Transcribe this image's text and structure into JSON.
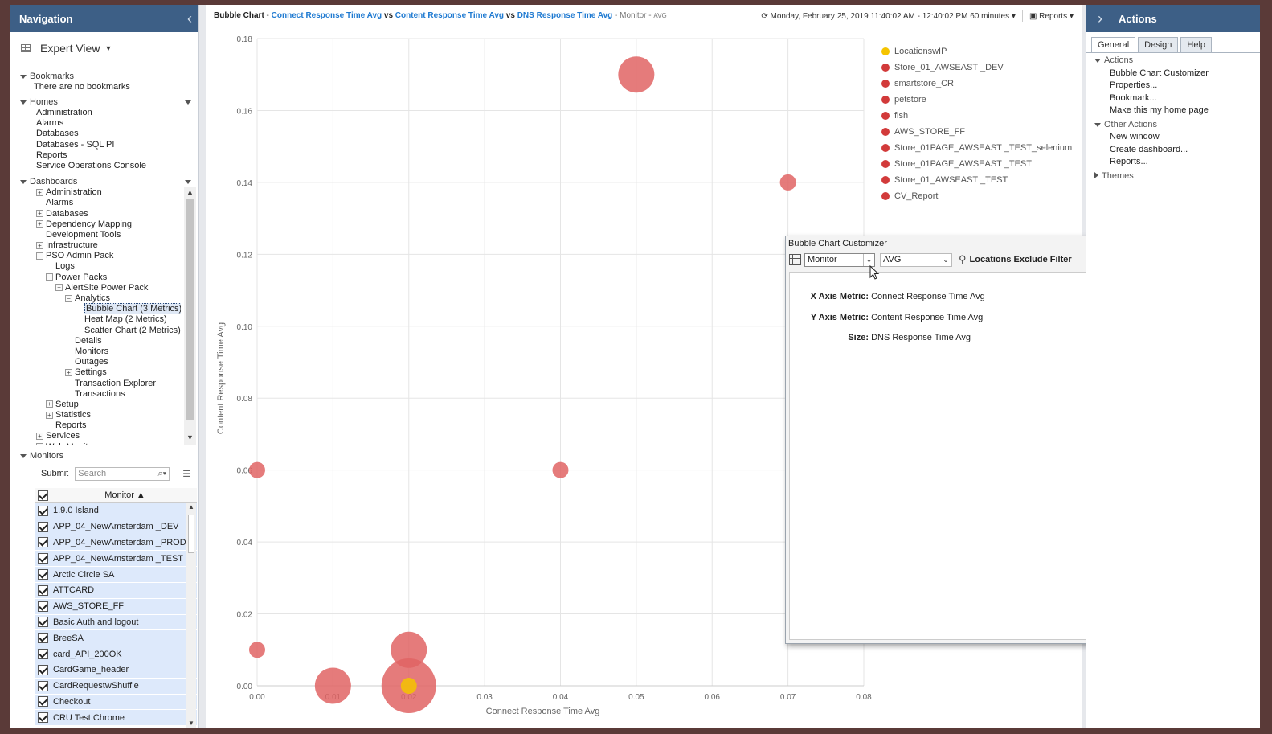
{
  "nav": {
    "title": "Navigation",
    "view_label": "Expert View",
    "bookmarks": {
      "title": "Bookmarks",
      "empty_text": "There are no bookmarks"
    },
    "homes": {
      "title": "Homes",
      "items": [
        "Administration",
        "Alarms",
        "Databases",
        "Databases - SQL PI",
        "Reports",
        "Service Operations Console"
      ]
    },
    "dashboards": {
      "title": "Dashboards",
      "items": [
        {
          "label": "Administration",
          "indent": 0,
          "exp": "+"
        },
        {
          "label": "Alarms",
          "indent": 0,
          "exp": ""
        },
        {
          "label": "Databases",
          "indent": 0,
          "exp": "+"
        },
        {
          "label": "Dependency Mapping",
          "indent": 0,
          "exp": "+"
        },
        {
          "label": "Development Tools",
          "indent": 0,
          "exp": ""
        },
        {
          "label": "Infrastructure",
          "indent": 0,
          "exp": "+"
        },
        {
          "label": "PSO Admin Pack",
          "indent": 0,
          "exp": "-"
        },
        {
          "label": "Logs",
          "indent": 1,
          "exp": ""
        },
        {
          "label": "Power Packs",
          "indent": 1,
          "exp": "-"
        },
        {
          "label": "AlertSite Power Pack",
          "indent": 2,
          "exp": "-"
        },
        {
          "label": "Analytics",
          "indent": 3,
          "exp": "-"
        },
        {
          "label": "Bubble Chart (3 Metrics)",
          "indent": 4,
          "exp": "",
          "selected": true
        },
        {
          "label": "Heat Map (2 Metrics)",
          "indent": 4,
          "exp": ""
        },
        {
          "label": "Scatter Chart (2 Metrics)",
          "indent": 4,
          "exp": ""
        },
        {
          "label": "Details",
          "indent": 3,
          "exp": ""
        },
        {
          "label": "Monitors",
          "indent": 3,
          "exp": ""
        },
        {
          "label": "Outages",
          "indent": 3,
          "exp": ""
        },
        {
          "label": "Settings",
          "indent": 3,
          "exp": "+"
        },
        {
          "label": "Transaction Explorer",
          "indent": 3,
          "exp": ""
        },
        {
          "label": "Transactions",
          "indent": 3,
          "exp": ""
        },
        {
          "label": "Setup",
          "indent": 1,
          "exp": "+"
        },
        {
          "label": "Statistics",
          "indent": 1,
          "exp": "+"
        },
        {
          "label": "Reports",
          "indent": 1,
          "exp": ""
        },
        {
          "label": "Services",
          "indent": 0,
          "exp": "+"
        },
        {
          "label": "Web Monitor",
          "indent": 0,
          "exp": "+"
        }
      ]
    },
    "monitors": {
      "title": "Monitors",
      "submit_label": "Submit",
      "search_placeholder": "Search",
      "column_header": "Monitor ▲",
      "rows": [
        "1.9.0 Island",
        "APP_04_NewAmsterdam _DEV",
        "APP_04_NewAmsterdam _PROD",
        "APP_04_NewAmsterdam _TEST",
        "Arctic Circle SA",
        "ATTCARD",
        "AWS_STORE_FF",
        "Basic Auth and logout",
        "BreeSA",
        "card_API_200OK",
        "CardGame_header",
        "CardRequestwShuffle",
        "Checkout",
        "CRU Test Chrome"
      ]
    }
  },
  "header": {
    "prefix": "Bubble Chart",
    "sep1": " - ",
    "metric_x": "Connect Response Time Avg",
    "vs1": " vs ",
    "metric_y": "Content Response Time Avg",
    "vs2": " vs ",
    "metric_size": "DNS Response Time Avg",
    "suffix": " - Monitor - ",
    "agg": "AVG",
    "time_range": "Monday, February 25, 2019 11:40:02 AM - 12:40:02 PM 60 minutes",
    "reports_label": "Reports"
  },
  "chart_data": {
    "type": "scatter",
    "xlabel": "Connect Response Time Avg",
    "ylabel": "Content Response Time Avg",
    "xlim": [
      0,
      0.08
    ],
    "ylim": [
      0,
      0.18
    ],
    "x_ticks": [
      "0.00",
      "0.01",
      "0.02",
      "0.03",
      "0.04",
      "0.05",
      "0.06",
      "0.07",
      "0.08"
    ],
    "y_ticks": [
      "0.00",
      "0.02",
      "0.04",
      "0.06",
      "0.08",
      "0.10",
      "0.12",
      "0.14",
      "0.16",
      "0.18"
    ],
    "grid": true,
    "legend": [
      "LocationswIP",
      "Store_01_AWSEAST _DEV",
      "smartstore_CR",
      "petstore",
      "fish",
      "AWS_STORE_FF",
      "Store_01PAGE_AWSEAST _TEST_selenium",
      "Store_01PAGE_AWSEAST _TEST",
      "Store_01_AWSEAST _TEST",
      "CV_Report"
    ],
    "legend_colors": [
      "#f5c400",
      "#d23a3a",
      "#d23a3a",
      "#d23a3a",
      "#d23a3a",
      "#d23a3a",
      "#d23a3a",
      "#d23a3a",
      "#d23a3a",
      "#d23a3a"
    ],
    "points": [
      {
        "x": 0.05,
        "y": 0.17,
        "size": 0.045,
        "color": "#e06464"
      },
      {
        "x": 0.07,
        "y": 0.14,
        "size": 0.02,
        "color": "#e06464"
      },
      {
        "x": 0.0,
        "y": 0.06,
        "size": 0.02,
        "color": "#e06464"
      },
      {
        "x": 0.04,
        "y": 0.06,
        "size": 0.02,
        "color": "#e06464"
      },
      {
        "x": 0.0,
        "y": 0.01,
        "size": 0.02,
        "color": "#e06464"
      },
      {
        "x": 0.02,
        "y": 0.01,
        "size": 0.045,
        "color": "#e06464"
      },
      {
        "x": 0.01,
        "y": 0.0,
        "size": 0.045,
        "color": "#e06464"
      },
      {
        "x": 0.02,
        "y": 0.0,
        "size": 0.068,
        "color": "#e06464"
      },
      {
        "x": 0.02,
        "y": 0.0,
        "size": 0.02,
        "color": "#f5c400"
      }
    ]
  },
  "customizer": {
    "title": "Bubble Chart Customizer",
    "monitor_select": "Monitor",
    "agg_select": "AVG",
    "filter_label": "Locations Exclude Filter",
    "x_key": "X Axis Metric:",
    "x_val": "Connect Response Time Avg",
    "y_key": "Y Axis Metric:",
    "y_val": "Content Response Time Avg",
    "size_key": "Size:",
    "size_val": "DNS Response Time Avg"
  },
  "actions": {
    "title": "Actions",
    "tabs": [
      "General",
      "Design",
      "Help"
    ],
    "actions_title": "Actions",
    "items": [
      "Bubble Chart Customizer",
      "Properties...",
      "Bookmark...",
      "Make this my home page"
    ],
    "other_title": "Other Actions",
    "other_items": [
      "New window",
      "Create dashboard...",
      "Reports..."
    ],
    "themes": "Themes"
  }
}
